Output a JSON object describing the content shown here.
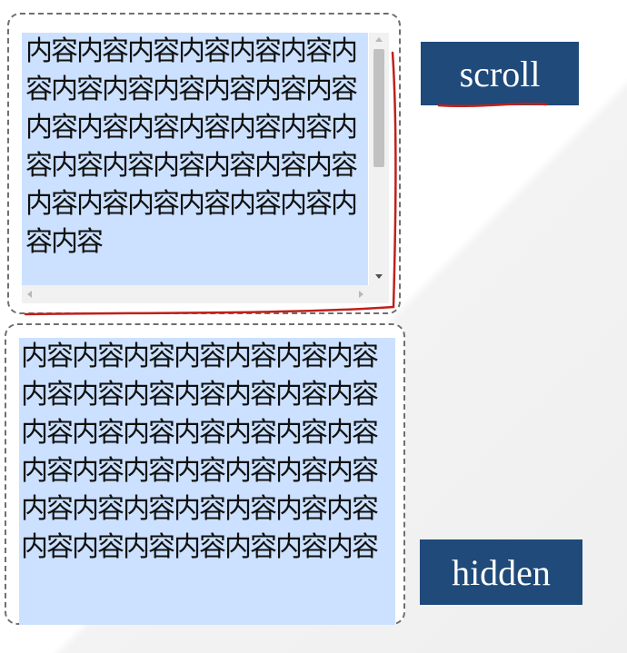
{
  "scroll_demo": {
    "label": "scroll",
    "text": "内容内容内容内容内容内容内容内容内容内容内容内容内容内容内容内容内容内容内容内容内容内容内容内容内容内容内容内容内容内容内容内容内容内容"
  },
  "hidden_demo": {
    "label": "hidden",
    "text": "内容内容内容内容内容内容内容内容内容内容内容内容内容内容内容内容内容内容内容内容内容内容内容内容内容内容内容内容内容内容内容内容内容内容内容内容内容内容内容内容内容内容"
  },
  "colors": {
    "content_bg": "#cce1ff",
    "label_bg": "#1f4a7a",
    "annotation": "#c0201c"
  }
}
